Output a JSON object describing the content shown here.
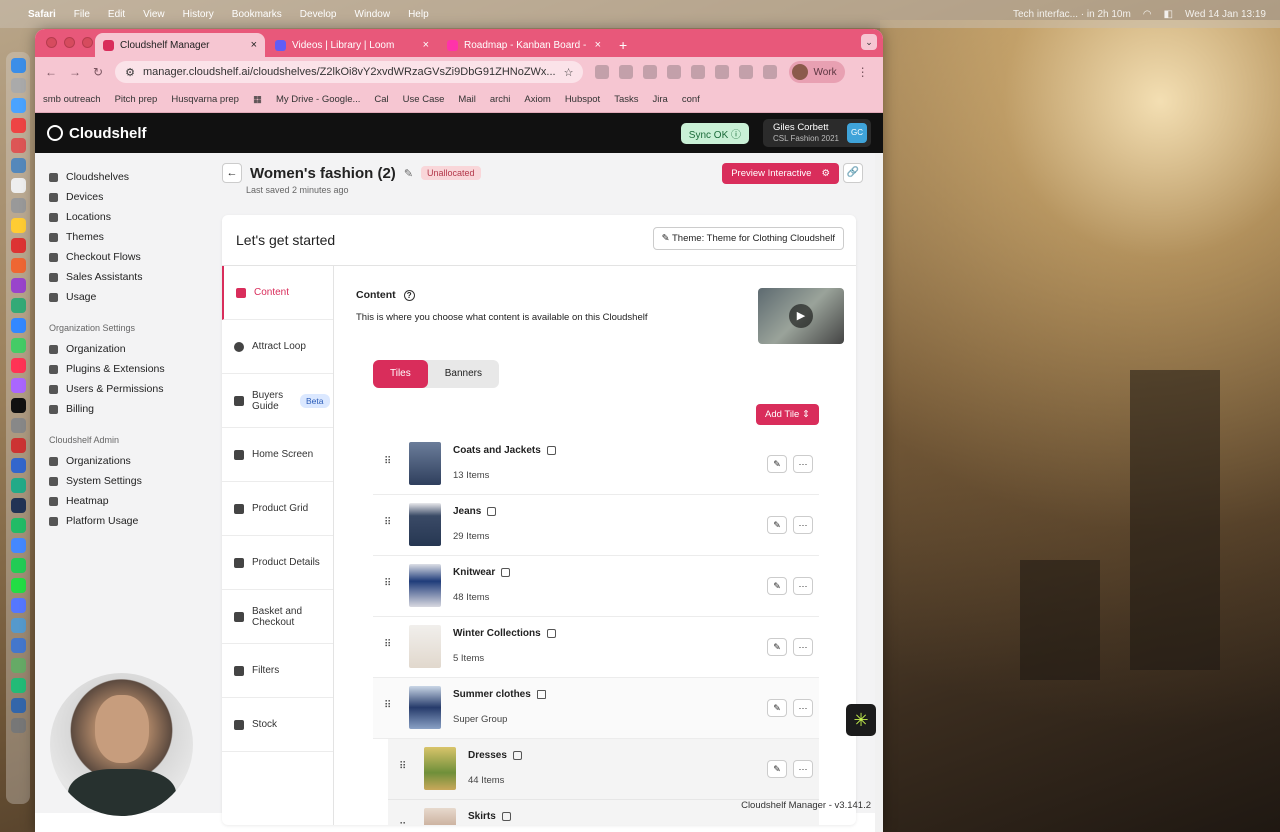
{
  "menubar": {
    "app": "Safari",
    "items": [
      "File",
      "Edit",
      "View",
      "History",
      "Bookmarks",
      "Develop",
      "Window",
      "Help"
    ],
    "status_text": "Tech interfac... · in 2h 10m",
    "clock": "Wed 14 Jan  13:19"
  },
  "browser": {
    "tabs": [
      {
        "title": "Cloudshelf Manager",
        "active": true
      },
      {
        "title": "Videos | Library | Loom",
        "active": false
      },
      {
        "title": "Roadmap - Kanban Board - ",
        "active": false
      }
    ],
    "url": "manager.cloudshelf.ai/cloudshelves/Z2lkOi8vY2xvdWRzaGVsZi9DbG91ZHNoZWx...",
    "profile": "Work",
    "bookmarks": [
      "smb outreach",
      "Pitch prep",
      "Husqvarna prep",
      "My Drive - Google...",
      "Cal",
      "Use Case",
      "Mail",
      "archi",
      "Axiom",
      "Hubspot",
      "Tasks",
      "Jira",
      "conf"
    ]
  },
  "app": {
    "logo": "Cloudshelf",
    "sync": "Sync OK ⓘ",
    "user_name": "Giles Corbett",
    "user_org": "CSL Fashion 2021",
    "user_initials": "GC",
    "nav": [
      {
        "label": "Cloudshelves"
      },
      {
        "label": "Devices"
      },
      {
        "label": "Locations"
      },
      {
        "label": "Themes"
      },
      {
        "label": "Checkout Flows"
      },
      {
        "label": "Sales Assistants"
      },
      {
        "label": "Usage"
      }
    ],
    "org_section": "Organization Settings",
    "org_nav": [
      {
        "label": "Organization"
      },
      {
        "label": "Plugins & Extensions"
      },
      {
        "label": "Users & Permissions"
      },
      {
        "label": "Billing"
      }
    ],
    "admin_section": "Cloudshelf Admin",
    "admin_nav": [
      {
        "label": "Organizations"
      },
      {
        "label": "System Settings"
      },
      {
        "label": "Heatmap"
      },
      {
        "label": "Platform Usage"
      }
    ],
    "page_title": "Women's fashion (2)",
    "status_badge": "Unallocated",
    "last_saved": "Last saved 2 minutes ago",
    "preview_label": "Preview Interactive",
    "card_title": "Let's get started",
    "theme_label": "Theme: Theme for Clothing Cloudshelf",
    "steps": [
      {
        "label": "Content",
        "active": true
      },
      {
        "label": "Attract Loop"
      },
      {
        "label": "Buyers Guide",
        "badge": "Beta"
      },
      {
        "label": "Home Screen"
      },
      {
        "label": "Product Grid"
      },
      {
        "label": "Product Details"
      },
      {
        "label": "Basket and Checkout"
      },
      {
        "label": "Filters"
      },
      {
        "label": "Stock"
      }
    ],
    "content_title": "Content",
    "content_desc": "This is where you choose what content is available on this Cloudshelf",
    "segments": [
      "Tiles",
      "Banners"
    ],
    "add_tile": "Add Tile",
    "tiles": [
      {
        "name": "Coats and Jackets",
        "count": "13 Items"
      },
      {
        "name": "Jeans",
        "count": "29 Items"
      },
      {
        "name": "Knitwear",
        "count": "48 Items"
      },
      {
        "name": "Winter Collections",
        "count": "5 Items"
      },
      {
        "name": "Summer clothes",
        "count": "Super Group"
      },
      {
        "name": "Dresses",
        "count": "44 Items"
      },
      {
        "name": "Skirts",
        "count": ""
      }
    ],
    "version": "Cloudshelf Manager - v3.141.2"
  },
  "colors": {
    "accent": "#d92d5b",
    "header": "#111111",
    "browser_chrome": "#e8587a"
  }
}
